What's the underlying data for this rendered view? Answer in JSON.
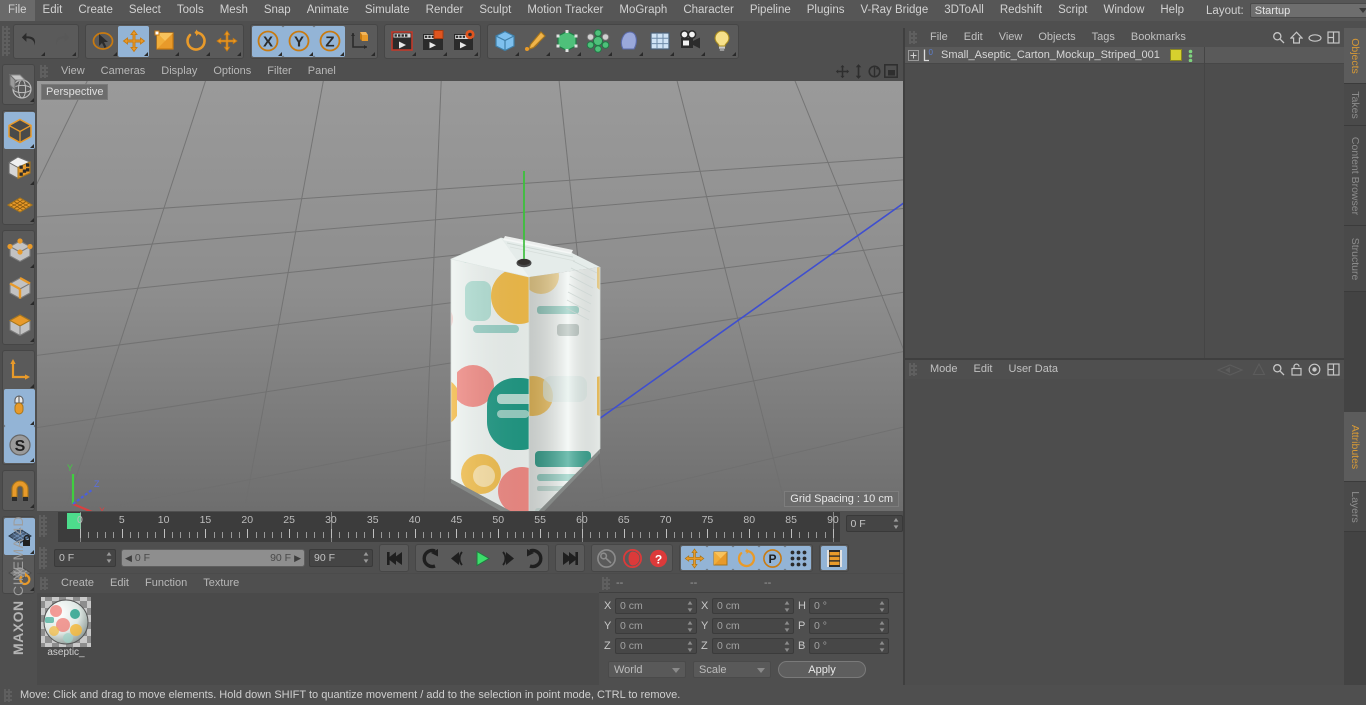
{
  "app": {
    "title": "MAXON CINEMA 4D",
    "brand_bold": "MAXON",
    "brand_rest": "CINEMA 4D"
  },
  "menubar": {
    "items": [
      "File",
      "Edit",
      "Create",
      "Select",
      "Tools",
      "Mesh",
      "Snap",
      "Animate",
      "Simulate",
      "Render",
      "Sculpt",
      "Motion Tracker",
      "MoGraph",
      "Character",
      "Pipeline",
      "Plugins",
      "V-Ray Bridge",
      "3DToAll",
      "Redshift",
      "Script",
      "Window",
      "Help"
    ],
    "layout_label": "Layout:",
    "layout_value": "Startup"
  },
  "toolbar": {
    "groups": [
      {
        "name": "undo-redo",
        "buttons": [
          {
            "icon": "undo-icon",
            "label": "Undo",
            "active": false
          },
          {
            "icon": "redo-icon",
            "label": "Redo",
            "active": false
          }
        ]
      },
      {
        "name": "transform-tools",
        "buttons": [
          {
            "icon": "select-arrow-icon",
            "label": "Live Selection",
            "active": false
          },
          {
            "icon": "move-icon",
            "label": "Move",
            "active": true
          },
          {
            "icon": "scale-icon",
            "label": "Scale",
            "active": false
          },
          {
            "icon": "rotate-icon",
            "label": "Rotate",
            "active": false
          },
          {
            "icon": "move-alt-icon",
            "label": "Move Alt",
            "active": false
          }
        ]
      },
      {
        "name": "axis-locks",
        "buttons": [
          {
            "icon": "x-axis-icon",
            "label": "X Axis",
            "active": true
          },
          {
            "icon": "y-axis-icon",
            "label": "Y Axis",
            "active": true
          },
          {
            "icon": "z-axis-icon",
            "label": "Z Axis",
            "active": true
          },
          {
            "icon": "world-axis-icon",
            "label": "World/Object Axis",
            "active": false
          }
        ]
      },
      {
        "name": "render-tools",
        "buttons": [
          {
            "icon": "render-view-icon",
            "label": "Render View",
            "active": false
          },
          {
            "icon": "render-region-icon",
            "label": "Render Region",
            "active": false
          },
          {
            "icon": "render-settings-icon",
            "label": "Render Settings",
            "active": false
          }
        ]
      },
      {
        "name": "create-tools",
        "buttons": [
          {
            "icon": "cube-primitive-icon",
            "label": "Add Cube Object",
            "active": false
          },
          {
            "icon": "spline-pen-icon",
            "label": "Add Spline",
            "active": false
          },
          {
            "icon": "generator-icon",
            "label": "Add Generator",
            "active": false
          },
          {
            "icon": "deformer-icon",
            "label": "Add Deformer",
            "active": false
          },
          {
            "icon": "environment-icon",
            "label": "Add Environment",
            "active": false
          },
          {
            "icon": "scene-icon",
            "label": "Add Scene Object",
            "active": false
          },
          {
            "icon": "camera-icon",
            "label": "Add Camera",
            "active": false
          },
          {
            "icon": "light-icon",
            "label": "Add Light",
            "active": false
          }
        ]
      }
    ]
  },
  "left_toolbar": {
    "groups": [
      {
        "name": "make-editable",
        "buttons": [
          {
            "icon": "make-editable-icon",
            "label": "Make Editable",
            "active": false
          }
        ]
      },
      {
        "name": "mode-tools",
        "buttons": [
          {
            "icon": "model-mode-icon",
            "label": "Model Mode",
            "active": true
          },
          {
            "icon": "texture-mode-icon",
            "label": "Texture Mode",
            "active": false
          },
          {
            "icon": "axis-plane-icon",
            "label": "Workplane",
            "active": false
          }
        ]
      },
      {
        "name": "component-modes",
        "buttons": [
          {
            "icon": "points-mode-icon",
            "label": "Points",
            "active": false
          },
          {
            "icon": "edges-mode-icon",
            "label": "Edges",
            "active": false
          },
          {
            "icon": "polygons-mode-icon",
            "label": "Polygons",
            "active": false
          }
        ]
      },
      {
        "name": "axis-tools",
        "buttons": [
          {
            "icon": "object-axis-icon",
            "label": "Enable Axis",
            "active": false
          },
          {
            "icon": "viewport-solo-icon",
            "label": "Viewport Solo",
            "active": true
          },
          {
            "icon": "soft-selection-icon",
            "label": "Soft Selection",
            "active": true
          }
        ]
      },
      {
        "name": "snap-tools",
        "buttons": [
          {
            "icon": "magnet-icon",
            "label": "Enable Snap",
            "active": false
          }
        ]
      },
      {
        "name": "workplane-tools",
        "buttons": [
          {
            "icon": "workplane-lock-icon",
            "label": "Lock Workplane",
            "active": true
          },
          {
            "icon": "workplane-rotate-icon",
            "label": "Planar Workplane Rotate",
            "active": false
          }
        ]
      }
    ]
  },
  "viewport": {
    "menus": [
      "View",
      "Cameras",
      "Display",
      "Options",
      "Filter",
      "Panel"
    ],
    "label": "Perspective",
    "grid_spacing": "Grid Spacing : 10 cm",
    "nav_icons": [
      "pan-icon",
      "dolly-icon",
      "rotate-view-icon",
      "maximize-view-icon"
    ],
    "axis_labels": {
      "x": "X",
      "y": "Y",
      "z": "Z"
    },
    "axis_colors": {
      "x": "#dd3b3b",
      "y": "#41c541",
      "z": "#4f6fe0"
    },
    "model": {
      "name": "Small Aseptic Carton",
      "palette": {
        "carton_base": "#eef3f0",
        "teal": "#1f9e87",
        "coral": "#f08a84",
        "yellow": "#f3b93c",
        "mint": "#bfe0d8"
      }
    }
  },
  "timeline": {
    "ticks": [
      0,
      5,
      10,
      15,
      20,
      25,
      30,
      35,
      40,
      45,
      50,
      55,
      60,
      65,
      70,
      75,
      80,
      85,
      90
    ],
    "current_frame_field": "0 F",
    "playhead_frame": 0,
    "max_frame": 90
  },
  "transport": {
    "current_frame": "0 F",
    "range_start": "0 F",
    "range_end": "90 F",
    "end_frame": "90 F",
    "buttons": [
      {
        "icon": "go-to-start-icon",
        "label": "Go to Start",
        "active": false
      },
      {
        "icon": "prev-key-icon",
        "label": "Go to Previous Key",
        "active": false
      },
      {
        "icon": "step-back-icon",
        "label": "Go to Previous Frame",
        "active": false
      },
      {
        "icon": "play-icon",
        "label": "Play Forwards",
        "active": false
      },
      {
        "icon": "step-forward-icon",
        "label": "Go to Next Frame",
        "active": false
      },
      {
        "icon": "next-key-icon",
        "label": "Go to Next Key",
        "active": false
      },
      {
        "icon": "go-to-end-icon",
        "label": "Go to End",
        "active": false
      }
    ],
    "record_buttons": [
      {
        "icon": "autokey-icon",
        "label": "Autokeying",
        "active": false
      },
      {
        "icon": "record-icon",
        "label": "Record Active Objects",
        "active": false
      },
      {
        "icon": "keyframe-selection-icon",
        "label": "Keyframe Selection",
        "active": false
      }
    ],
    "param_buttons": [
      {
        "icon": "record-position-icon",
        "label": "Position",
        "active": true
      },
      {
        "icon": "record-scale-icon",
        "label": "Scale",
        "active": true
      },
      {
        "icon": "record-rotation-icon",
        "label": "Rotation",
        "active": true
      },
      {
        "icon": "record-pla-icon",
        "label": "Point Level Animation",
        "active": true
      },
      {
        "icon": "record-params-icon",
        "label": "Parameter",
        "active": true
      }
    ],
    "timeline_toggle": {
      "icon": "timeline-icon",
      "label": "Animation Timeline",
      "active": true
    }
  },
  "material_panel": {
    "menus": [
      "Create",
      "Edit",
      "Function",
      "Texture"
    ],
    "materials": [
      {
        "name": "aseptic_"
      }
    ]
  },
  "coordinates": {
    "header": [
      "--",
      "--",
      "--"
    ],
    "rows": [
      {
        "axis1": "X",
        "value1": "0 cm",
        "axis2": "X",
        "value2": "0 cm",
        "axis3": "H",
        "value3": "0 °"
      },
      {
        "axis1": "Y",
        "value1": "0 cm",
        "axis2": "Y",
        "value2": "0 cm",
        "axis3": "P",
        "value3": "0 °"
      },
      {
        "axis1": "Z",
        "value1": "0 cm",
        "axis2": "Z",
        "value2": "0 cm",
        "axis3": "B",
        "value3": "0 °"
      }
    ],
    "system": "World",
    "mode": "Scale",
    "apply": "Apply"
  },
  "object_manager": {
    "menus": [
      "File",
      "Edit",
      "View",
      "Objects",
      "Tags",
      "Bookmarks"
    ],
    "icons": [
      "search-icon",
      "home-icon",
      "ellipse-icon",
      "layout-icon"
    ],
    "objects": [
      {
        "name": "Small_Aseptic_Carton_Mockup_Striped_001",
        "layer_index": "0",
        "tag_color": "#d6d02e",
        "selected": true
      }
    ]
  },
  "attribute_manager": {
    "menus": [
      "Mode",
      "Edit",
      "User Data"
    ],
    "icons": [
      "history-back-icon",
      "history-forward-icon",
      "search-icon",
      "lock-icon",
      "target-icon",
      "layout-icon"
    ]
  },
  "right_tabs": [
    {
      "label": "Objects",
      "active": true
    },
    {
      "label": "Takes",
      "active": false
    },
    {
      "label": "Content Browser",
      "active": false
    },
    {
      "label": "Structure",
      "active": false
    },
    {
      "label": "Attributes",
      "active": true
    },
    {
      "label": "Layers",
      "active": false
    }
  ],
  "statusbar": {
    "text": "Move: Click and drag to move elements. Hold down SHIFT to quantize movement / add to the selection in point mode, CTRL to remove."
  }
}
